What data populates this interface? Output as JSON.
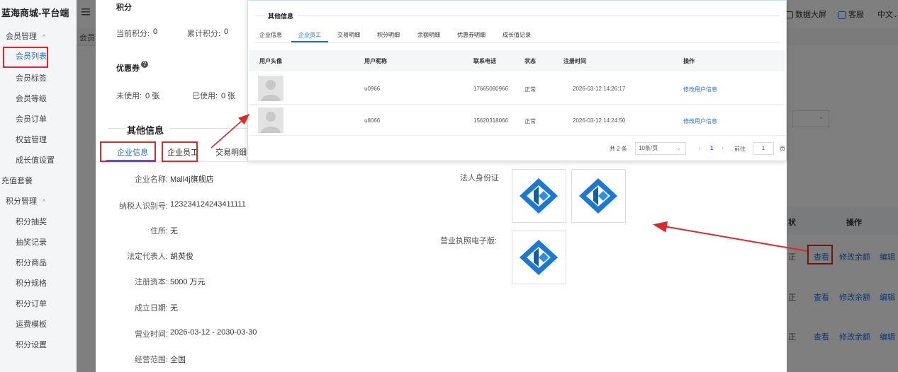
{
  "app": {
    "brand": "蓝海商城-平台端"
  },
  "sidebar": {
    "groups": [
      {
        "label": "会员管理",
        "caret": "^"
      },
      {
        "label": "充值套餐"
      },
      {
        "label": "积分管理",
        "caret": "^"
      }
    ],
    "member_items": [
      "会员列表",
      "会员标签",
      "会员等级",
      "会员订单",
      "权益管理",
      "成长值设置"
    ],
    "points_items": [
      "积分抽奖",
      "抽奖记录",
      "积分商品",
      "积分规格",
      "积分订单",
      "运费模板",
      "积分设置"
    ]
  },
  "header": {
    "data_screen": "数据大屏",
    "service": "客服",
    "lang": "中文",
    "tab_fragment": "会员"
  },
  "drawer": {
    "points_title": "积分",
    "current_points_label": "当前积分:",
    "current_points_value": "0",
    "total_points_label": "累计积分:",
    "total_points_value": "0",
    "coupon_title": "优惠券",
    "unused_label": "未使用:",
    "unused_value": "0 张",
    "used_label": "已使用:",
    "used_value": "0 张",
    "other_title": "其他信息",
    "tabs": [
      "企业信息",
      "企业员工",
      "交易明细"
    ],
    "fields": [
      {
        "label": "企业名称:",
        "value": "Mall4j旗舰店"
      },
      {
        "label": "纳税人识别号:",
        "value": "123234124243411111"
      },
      {
        "label": "住所:",
        "value": "无"
      },
      {
        "label": "法定代表人:",
        "value": "胡英俊"
      },
      {
        "label": "注册资本:",
        "value": "5000 万元"
      },
      {
        "label": "成立日期:",
        "value": "无"
      },
      {
        "label": "营业时间:",
        "value": "2026-03-12 - 2030-03-30"
      },
      {
        "label": "经营范围:",
        "value": "全国"
      }
    ],
    "id_card_label": "法人身份证",
    "license_label": "营业执照电子版:"
  },
  "popup": {
    "title": "其他信息",
    "tabs": [
      "企业信息",
      "企业员工",
      "交易明细",
      "积分明细",
      "余额明细",
      "优惠券明细",
      "成长值记录"
    ],
    "columns": [
      "用户头像",
      "用户昵称",
      "联系电话",
      "状态",
      "注册时间",
      "操作"
    ],
    "rows": [
      {
        "nickname": "u0966",
        "phone": "17665080966",
        "status": "正常",
        "reg_time": "2026-03-12 14:26:17",
        "action": "修改用户信息"
      },
      {
        "nickname": "u8066",
        "phone": "15620318066",
        "status": "正常",
        "reg_time": "2026-03-12 14:24:50",
        "action": "修改用户信息"
      }
    ],
    "pager": {
      "total": "共 2 条",
      "page_size": "10条/页",
      "current": "1",
      "goto_label": "前往",
      "goto_value": "1",
      "page_unit": "页"
    }
  },
  "background_table": {
    "status_col": "状",
    "action_col": "操作",
    "status_cell": "正",
    "rows": [
      {
        "view": "查看",
        "edit_balance": "修改余额",
        "edit": "编辑"
      },
      {
        "view": "查看",
        "edit_balance": "修改余额",
        "edit": "编辑"
      },
      {
        "view": "查看",
        "edit_balance": "修改余额",
        "edit": "编辑"
      }
    ]
  },
  "colors": {
    "accent": "#1d6fe0",
    "annotation_red": "#e02828",
    "logo_blue": "#1a78d6"
  }
}
